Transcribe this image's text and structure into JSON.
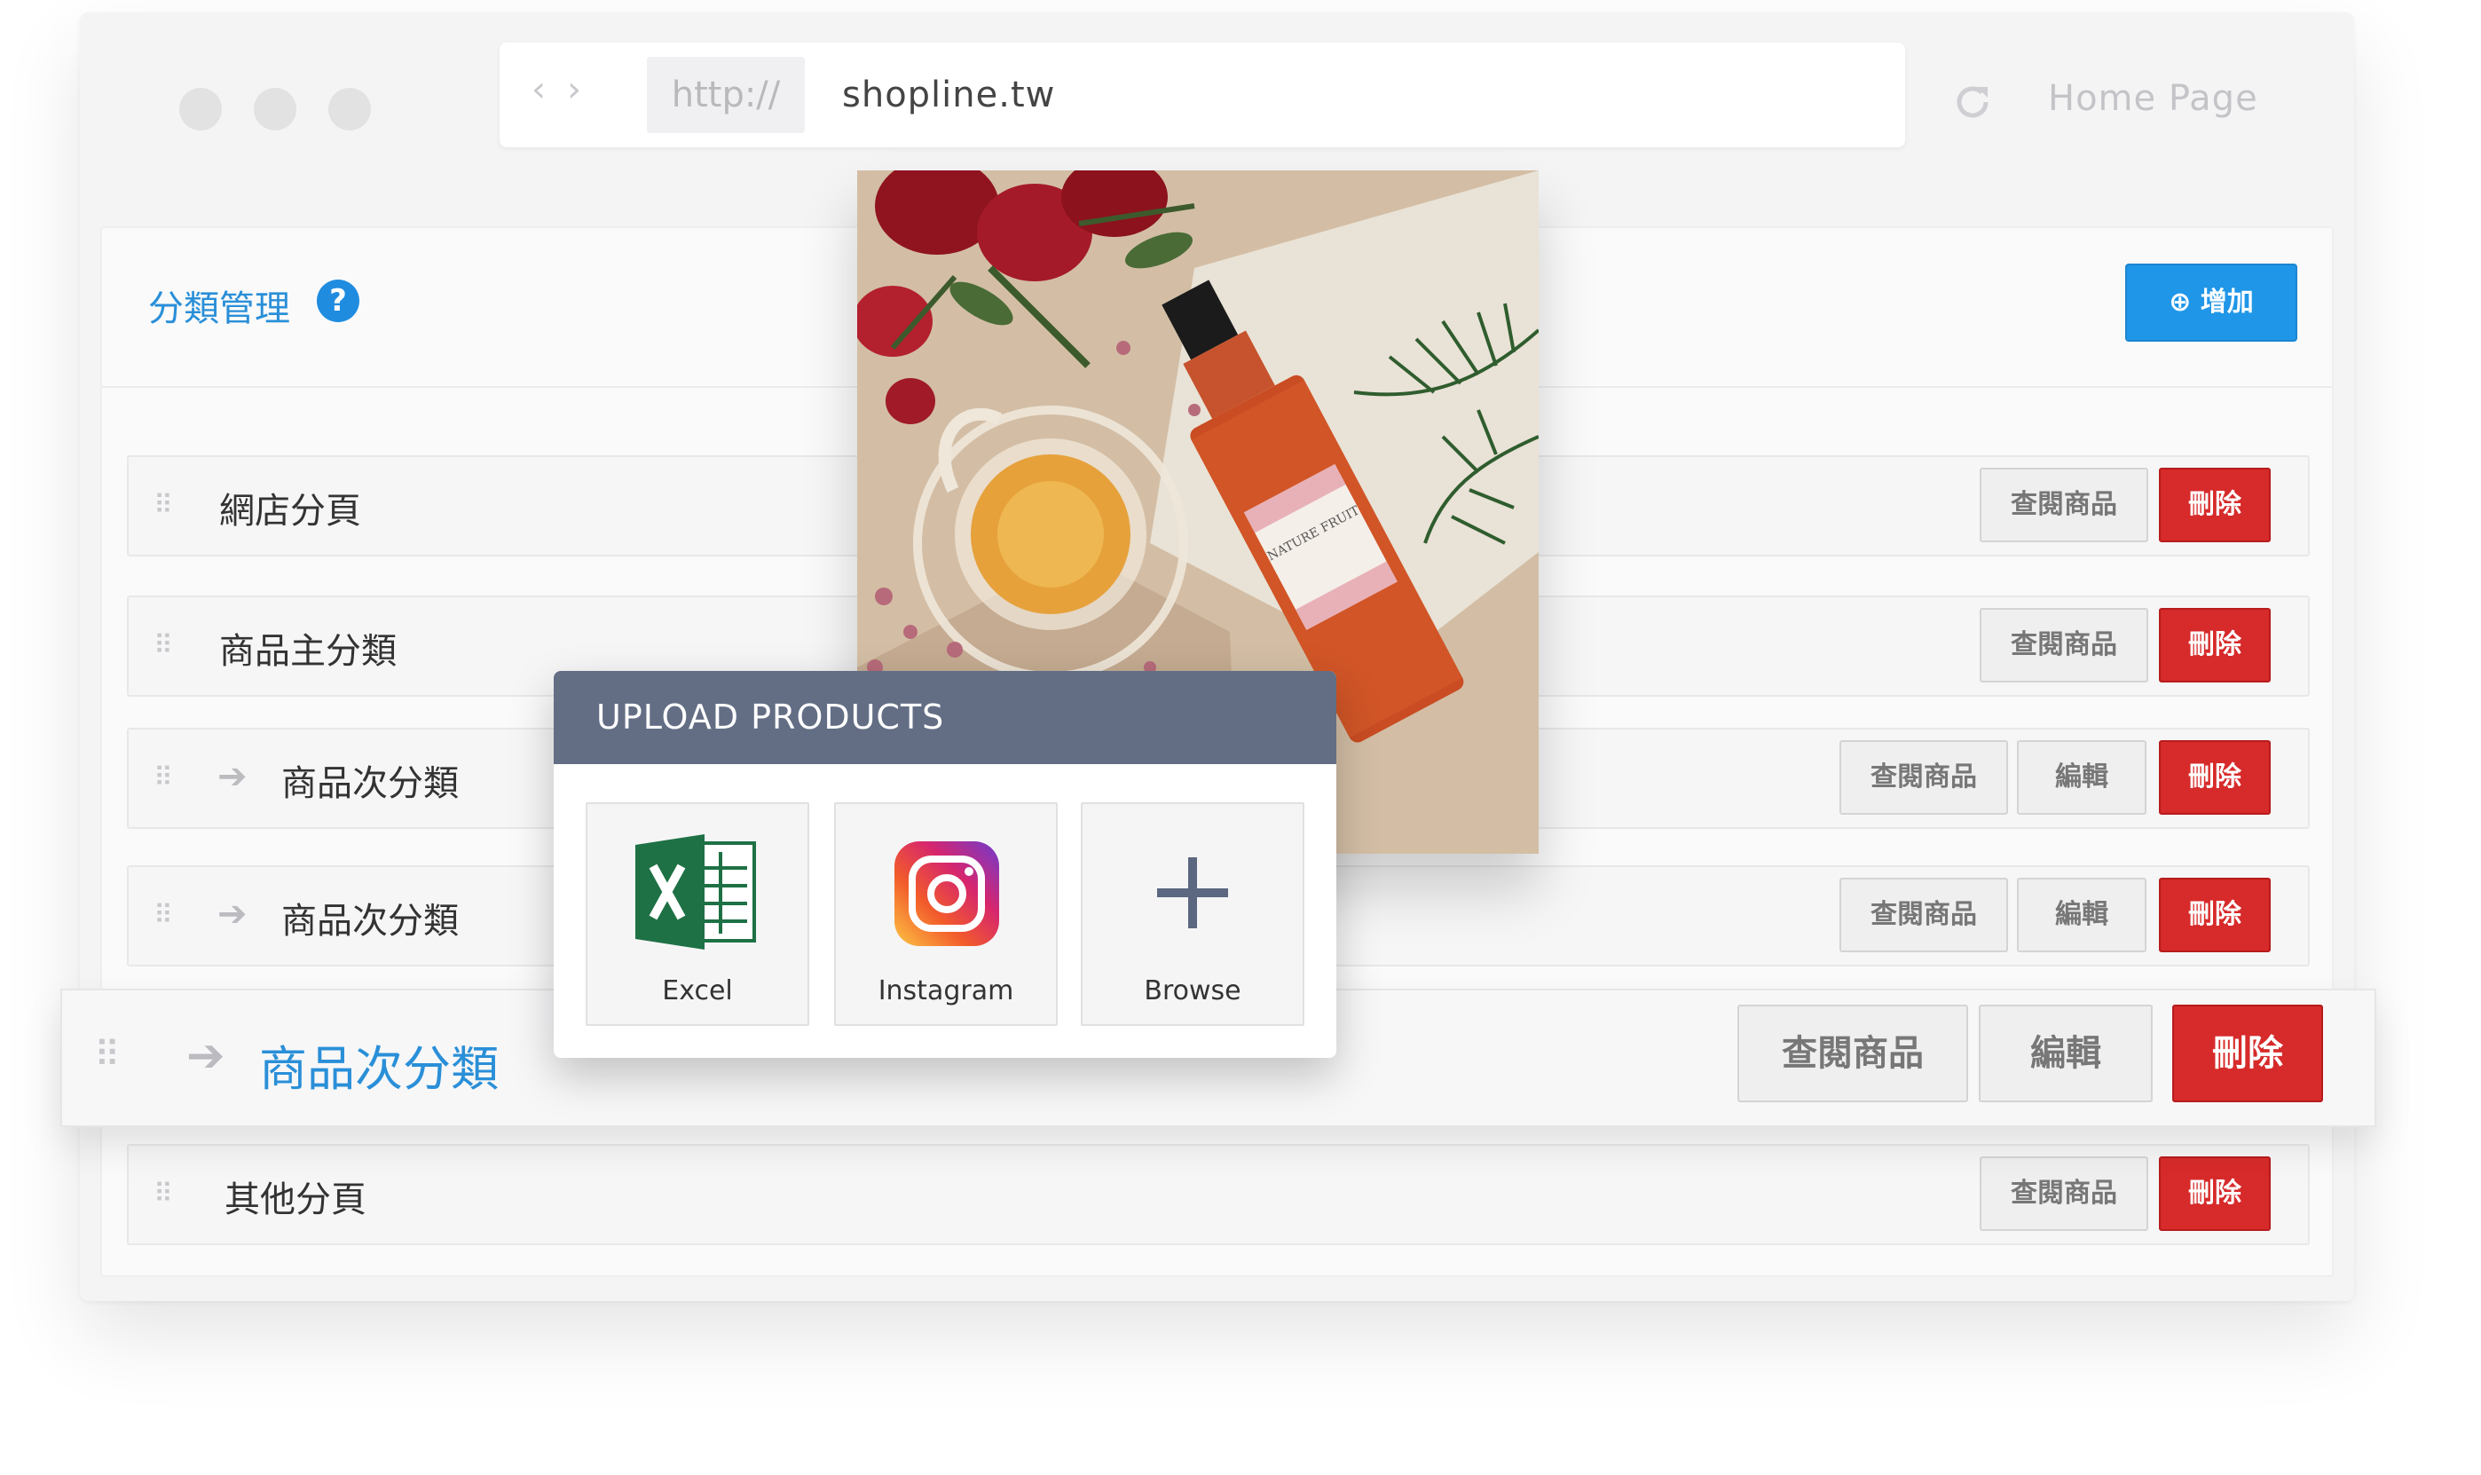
{
  "browser": {
    "protocol": "http://",
    "domain": "shopline.tw",
    "nav_back": "‹",
    "nav_forward": "›",
    "reload_icon": "reload-icon",
    "home_label": "Home Page"
  },
  "panel": {
    "title": "分類管理",
    "help_glyph": "?",
    "add_button": "⊕ 增加"
  },
  "buttons": {
    "view": "查閱商品",
    "edit": "編輯",
    "delete": "刪除"
  },
  "rows": [
    {
      "label": "網店分頁"
    },
    {
      "label": "商品主分類"
    },
    {
      "label": "商品次分類"
    },
    {
      "label": "商品次分類"
    },
    {
      "label": "商品次分類"
    },
    {
      "label": "其他分頁"
    }
  ],
  "upload": {
    "title": "UPLOAD PRODUCTS",
    "options": [
      {
        "label": "Excel",
        "icon": "excel-icon"
      },
      {
        "label": "Instagram",
        "icon": "instagram-icon"
      },
      {
        "label": "Browse",
        "icon": "plus-icon"
      }
    ]
  },
  "photo": {
    "label_text": "NATURE FRUIT"
  },
  "colors": {
    "accent_blue": "#1f96e8",
    "delete_red": "#d72a2a",
    "upload_header": "#636e85"
  }
}
